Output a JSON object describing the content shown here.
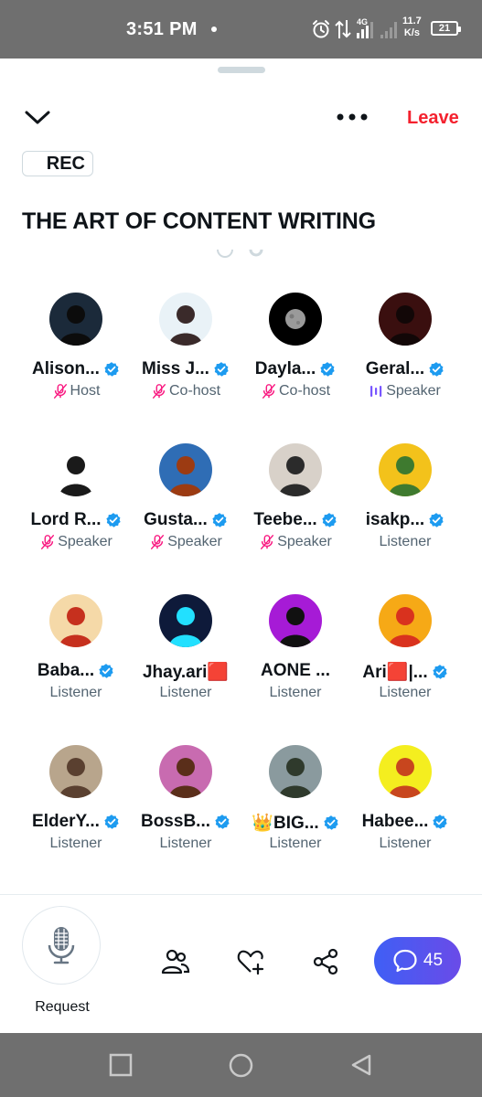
{
  "status_bar": {
    "time": "3:51 PM",
    "network": "4G",
    "speed_value": "11.7",
    "speed_unit": "K/s",
    "battery": "21"
  },
  "header": {
    "leave_label": "Leave",
    "rec_label": "REC"
  },
  "space": {
    "title": "THE ART OF CONTENT WRITING"
  },
  "participants": [
    {
      "name": "Alison...",
      "role": "Host",
      "verified": true,
      "mic": "muted",
      "avatar_icon": "hooded-figure-avatar",
      "bg": "#1b2a3a"
    },
    {
      "name": "Miss J...",
      "role": "Co-host",
      "verified": true,
      "mic": "muted",
      "avatar_icon": "anime-girl-avatar",
      "bg": "#e9f2f7"
    },
    {
      "name": "Dayla...",
      "role": "Co-host",
      "verified": true,
      "mic": "muted",
      "avatar_icon": "moon-avatar",
      "bg": "#000000"
    },
    {
      "name": "Geral...",
      "role": "Speaker",
      "verified": true,
      "mic": "speaking",
      "avatar_icon": "red-portrait-avatar",
      "bg": "#3a0f0f"
    },
    {
      "name": "Lord R...",
      "role": "Speaker",
      "verified": true,
      "mic": "muted",
      "avatar_icon": "cartoon-cap-avatar",
      "bg": "#ffffff"
    },
    {
      "name": "Gusta...",
      "role": "Speaker",
      "verified": true,
      "mic": "muted",
      "avatar_icon": "cartoon-face-avatar",
      "bg": "#2f6db5"
    },
    {
      "name": "Teebe...",
      "role": "Speaker",
      "verified": true,
      "mic": "muted",
      "avatar_icon": "woman-photo-avatar",
      "bg": "#d8d1c9"
    },
    {
      "name": "isakp...",
      "role": "Listener",
      "verified": true,
      "mic": "none",
      "avatar_icon": "green-cartoon-avatar",
      "bg": "#f3c21b"
    },
    {
      "name": "Baba...",
      "role": "Listener",
      "verified": true,
      "mic": "none",
      "avatar_icon": "red-creature-avatar",
      "bg": "#f5d9a8"
    },
    {
      "name": "Jhay.ari🟥",
      "role": "Listener",
      "verified": false,
      "mic": "none",
      "avatar_icon": "neon-glasses-avatar",
      "bg": "#0e1a3a"
    },
    {
      "name": "AONE ...",
      "role": "Listener",
      "verified": false,
      "mic": "none",
      "avatar_icon": "purple-figure-avatar",
      "bg": "#a61bd6"
    },
    {
      "name": "Ari🟥|...",
      "role": "Listener",
      "verified": true,
      "mic": "none",
      "avatar_icon": "pixel-character-avatar",
      "bg": "#f6a916"
    },
    {
      "name": "ElderY...",
      "role": "Listener",
      "verified": true,
      "mic": "none",
      "avatar_icon": "man-photo-avatar",
      "bg": "#b8a58c"
    },
    {
      "name": "BossB...",
      "role": "Listener",
      "verified": true,
      "mic": "none",
      "avatar_icon": "woman-cartoon-avatar",
      "bg": "#c86bb0"
    },
    {
      "name": "👑BIG...",
      "role": "Listener",
      "verified": true,
      "mic": "none",
      "avatar_icon": "man-green-shirt-avatar",
      "bg": "#8a9a9e"
    },
    {
      "name": "Habee...",
      "role": "Listener",
      "verified": true,
      "mic": "none",
      "avatar_icon": "antler-cartoon-avatar",
      "bg": "#f4ee1f"
    }
  ],
  "bottom_bar": {
    "request_label": "Request",
    "comment_count": "45"
  },
  "colors": {
    "leave": "#f4212e",
    "verified": "#1d9bf0",
    "muted_mic": "#f91880",
    "speaking": "#7856ff",
    "comment_button": "#5b48f0"
  }
}
